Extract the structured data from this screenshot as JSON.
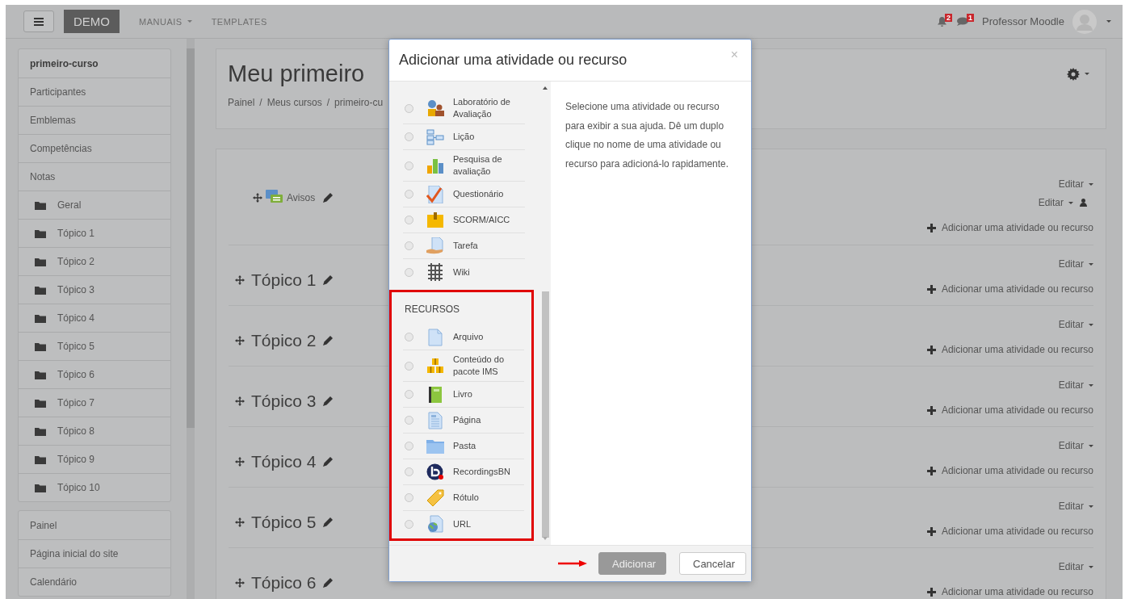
{
  "navbar": {
    "brand": "DEMO",
    "menu": [
      {
        "label": "MANUAIS",
        "dropdown": true
      },
      {
        "label": "TEMPLATES",
        "dropdown": false
      }
    ],
    "notifications": "2",
    "messages": "1",
    "user": "Professor Moodle"
  },
  "sidebar": {
    "course_nav": [
      {
        "label": "primeiro-curso",
        "kind": "title"
      },
      {
        "label": "Participantes",
        "kind": "link"
      },
      {
        "label": "Emblemas",
        "kind": "link"
      },
      {
        "label": "Competências",
        "kind": "link"
      },
      {
        "label": "Notas",
        "kind": "link"
      },
      {
        "label": "Geral",
        "kind": "folder"
      },
      {
        "label": "Tópico 1",
        "kind": "folder"
      },
      {
        "label": "Tópico 2",
        "kind": "folder"
      },
      {
        "label": "Tópico 3",
        "kind": "folder"
      },
      {
        "label": "Tópico 4",
        "kind": "folder"
      },
      {
        "label": "Tópico 5",
        "kind": "folder"
      },
      {
        "label": "Tópico 6",
        "kind": "folder"
      },
      {
        "label": "Tópico 7",
        "kind": "folder"
      },
      {
        "label": "Tópico 8",
        "kind": "folder"
      },
      {
        "label": "Tópico 9",
        "kind": "folder"
      },
      {
        "label": "Tópico 10",
        "kind": "folder"
      }
    ],
    "site_nav": [
      "Painel",
      "Página inicial do site",
      "Calendário"
    ]
  },
  "course": {
    "title": "Meu primeiro",
    "breadcrumb": [
      "Painel",
      "Meus cursos",
      "primeiro-cu"
    ],
    "breadcrumb_separator": "/"
  },
  "sections": [
    {
      "kind": "general",
      "activity": "Avisos",
      "edit_links": [
        "Editar",
        "Editar"
      ],
      "add_link": "Adicionar uma atividade ou recurso"
    },
    {
      "kind": "topic",
      "title": "Tópico 1",
      "edit_links": [
        "Editar"
      ],
      "add_link": "Adicionar uma atividade ou recurso"
    },
    {
      "kind": "topic",
      "title": "Tópico 2",
      "edit_links": [
        "Editar"
      ],
      "add_link": "Adicionar uma atividade ou recurso"
    },
    {
      "kind": "topic",
      "title": "Tópico 3",
      "edit_links": [
        "Editar"
      ],
      "add_link": "Adicionar uma atividade ou recurso"
    },
    {
      "kind": "topic",
      "title": "Tópico 4",
      "edit_links": [
        "Editar"
      ],
      "add_link": "Adicionar uma atividade ou recurso"
    },
    {
      "kind": "topic",
      "title": "Tópico 5",
      "edit_links": [
        "Editar"
      ],
      "add_link": "Adicionar uma atividade ou recurso"
    },
    {
      "kind": "topic",
      "title": "Tópico 6",
      "edit_links": [
        "Editar"
      ],
      "add_link": "Adicionar uma atividade ou recurso"
    }
  ],
  "modal": {
    "title": "Adicionar uma atividade ou recurso",
    "close": "×",
    "groups": [
      {
        "items": [
          {
            "label": "Laboratório de Avaliação",
            "kind": "workshop",
            "selected": false
          },
          {
            "label": "Lição",
            "kind": "lesson",
            "selected": false
          },
          {
            "label": "Pesquisa de avaliação",
            "kind": "feedback",
            "selected": false
          },
          {
            "label": "Questionário",
            "kind": "quiz",
            "selected": false
          },
          {
            "label": "SCORM/AICC",
            "kind": "scorm",
            "selected": false
          },
          {
            "label": "Tarefa",
            "kind": "assignment",
            "selected": false
          },
          {
            "label": "Wiki",
            "kind": "wiki",
            "selected": false
          }
        ]
      },
      {
        "heading": "RECURSOS",
        "highlighted": true,
        "items": [
          {
            "label": "Arquivo",
            "kind": "file",
            "selected": false
          },
          {
            "label": "Conteúdo do pacote IMS",
            "kind": "imscp",
            "selected": false
          },
          {
            "label": "Livro",
            "kind": "book",
            "selected": false
          },
          {
            "label": "Página",
            "kind": "page",
            "selected": false
          },
          {
            "label": "Pasta",
            "kind": "folder",
            "selected": false
          },
          {
            "label": "RecordingsBN",
            "kind": "bbb",
            "selected": false
          },
          {
            "label": "Rótulo",
            "kind": "label",
            "selected": false
          },
          {
            "label": "URL",
            "kind": "url",
            "selected": false
          }
        ]
      }
    ],
    "help": "Selecione uma atividade ou recurso para exibir a sua ajuda. Dê um duplo clique no nome de uma atividade ou recurso para adicioná-lo rapidamente.",
    "buttons": [
      {
        "label": "Adicionar",
        "kind": "primary",
        "disabled": true,
        "pointer_arrow": true
      },
      {
        "label": "Cancelar",
        "kind": "default",
        "disabled": false
      }
    ]
  }
}
